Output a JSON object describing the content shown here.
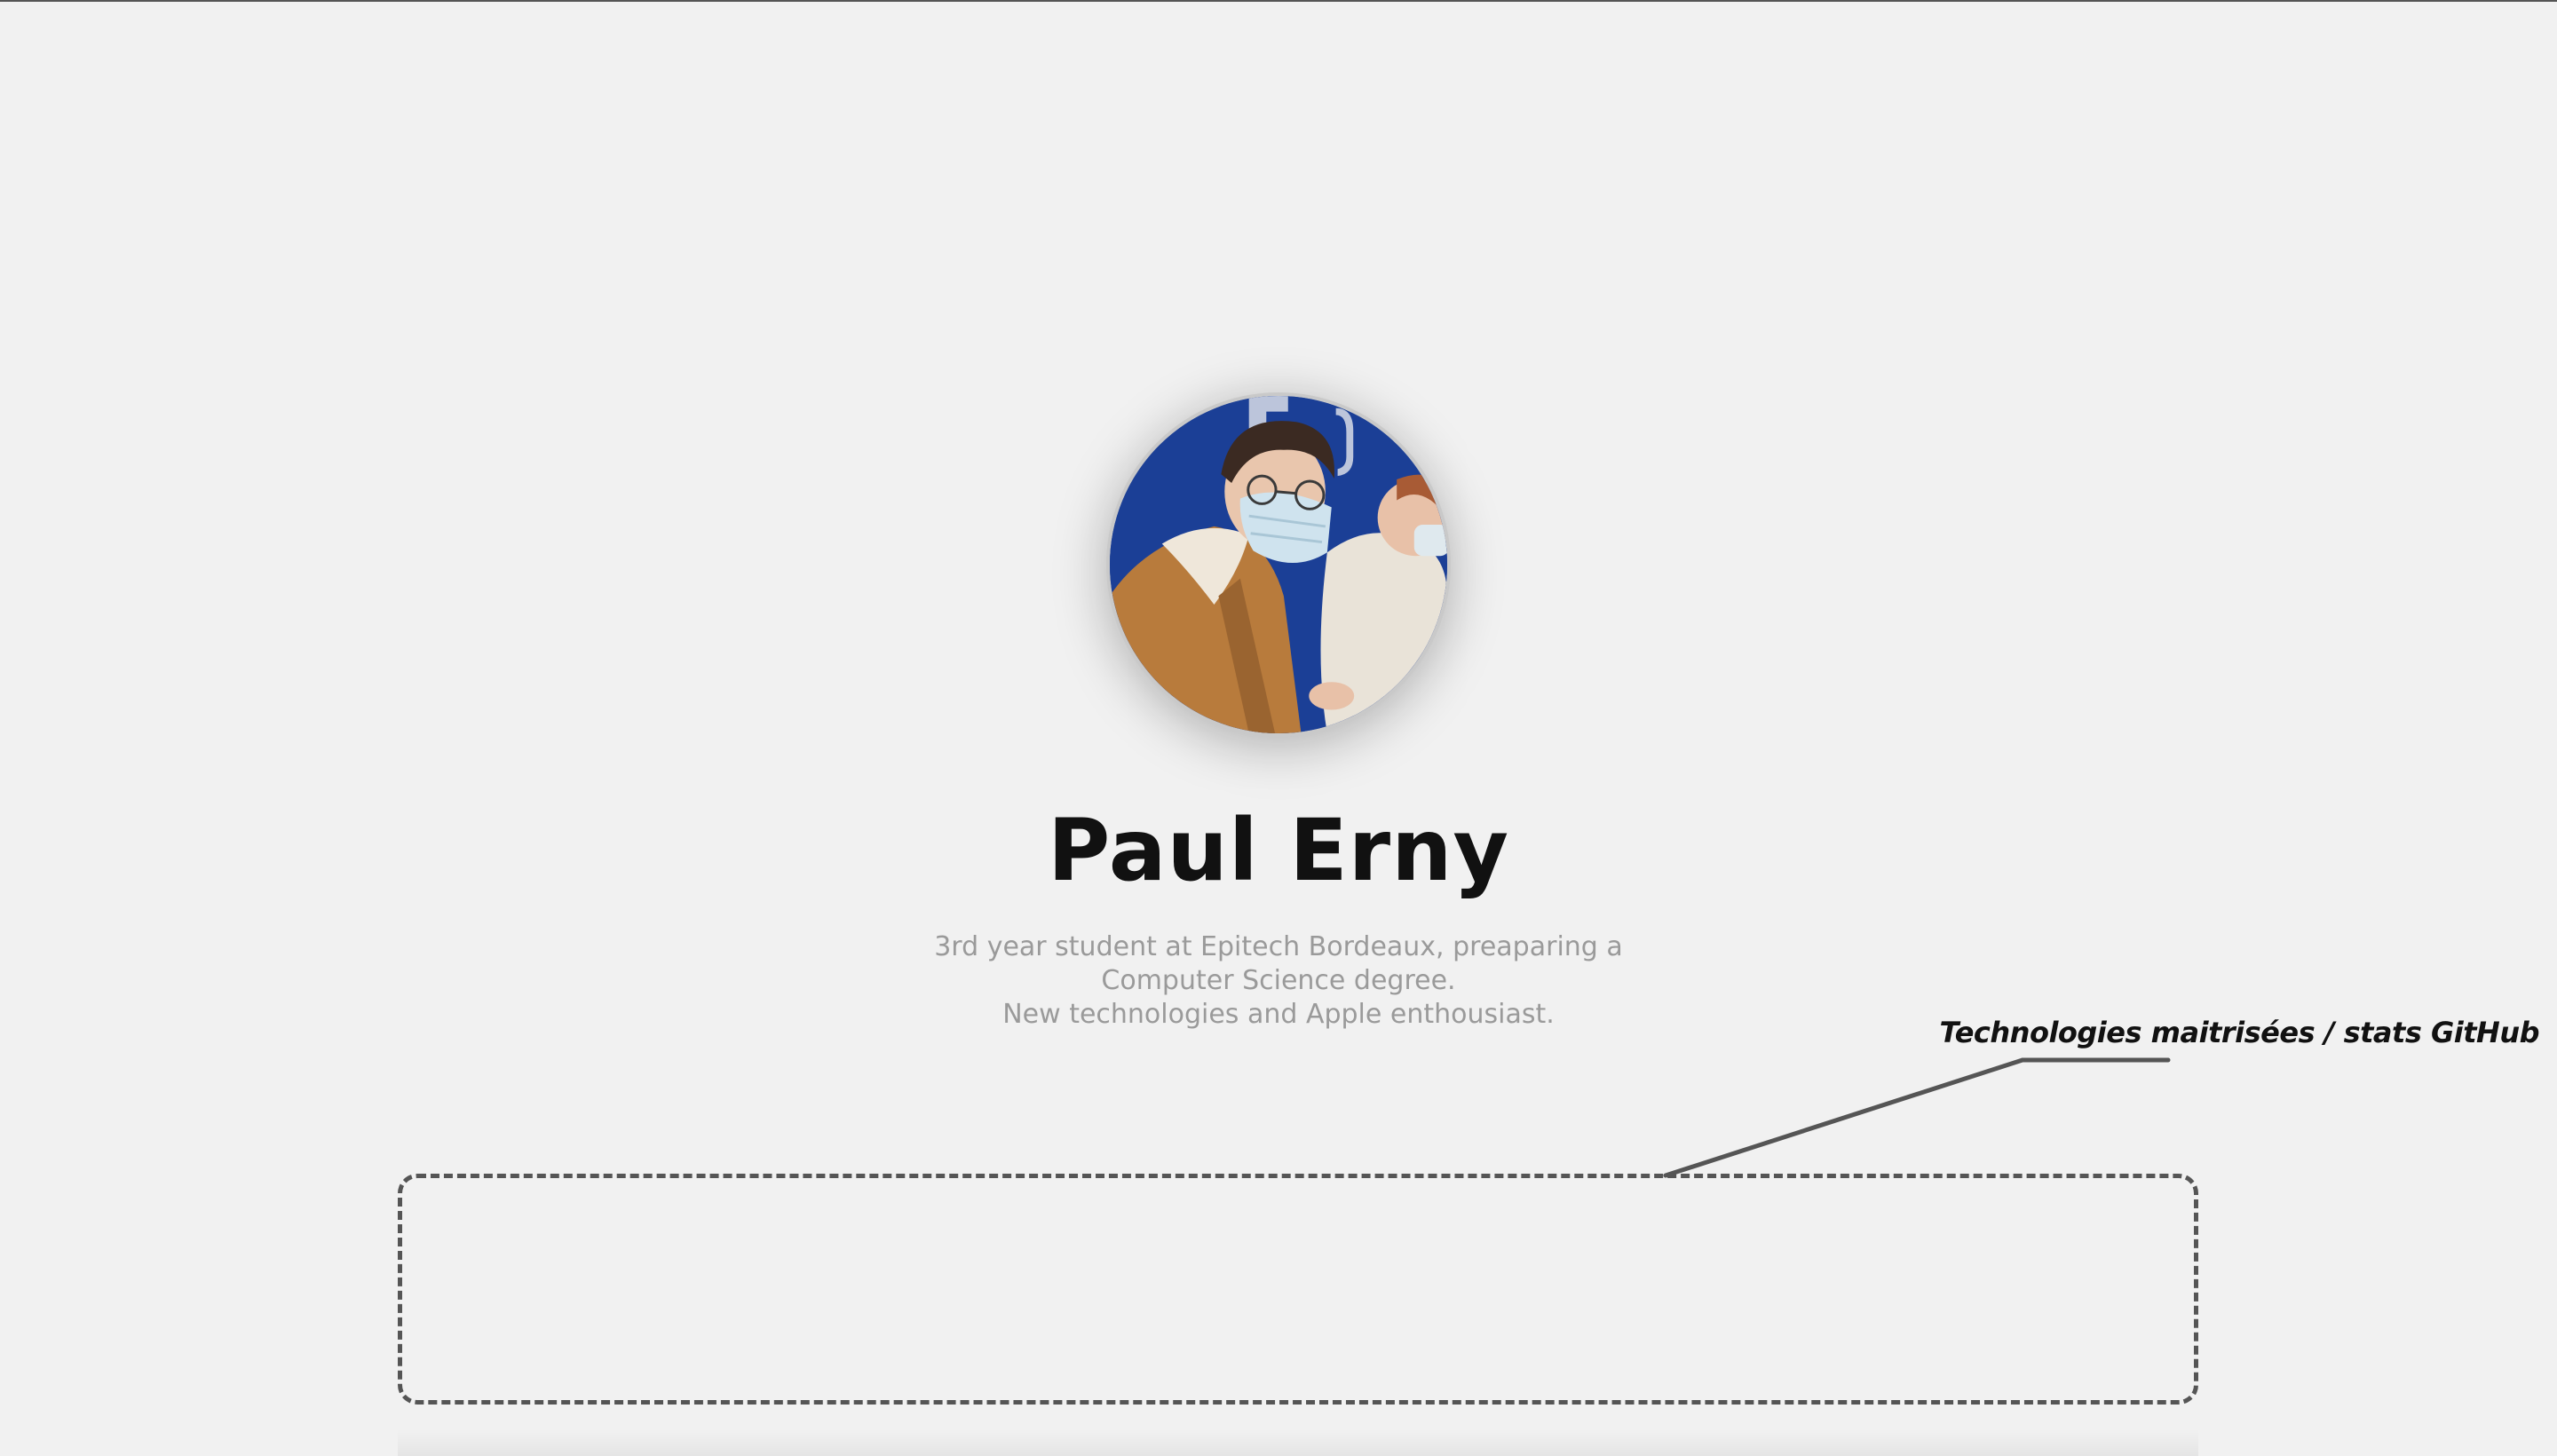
{
  "profile": {
    "name": "Paul Erny",
    "bio_lines": [
      "3rd year student at Epitech Bordeaux, preaparing a",
      "Computer Science degree.",
      "New technologies and Apple enthousiast."
    ]
  },
  "annotation": {
    "label": "Technologies maitrisées / stats GitHub"
  },
  "colors": {
    "background": "#f1f1f1",
    "text_primary": "#111111",
    "text_secondary": "#9a9a9a",
    "dash": "#555555",
    "photo_backdrop": "#1b3f96"
  }
}
